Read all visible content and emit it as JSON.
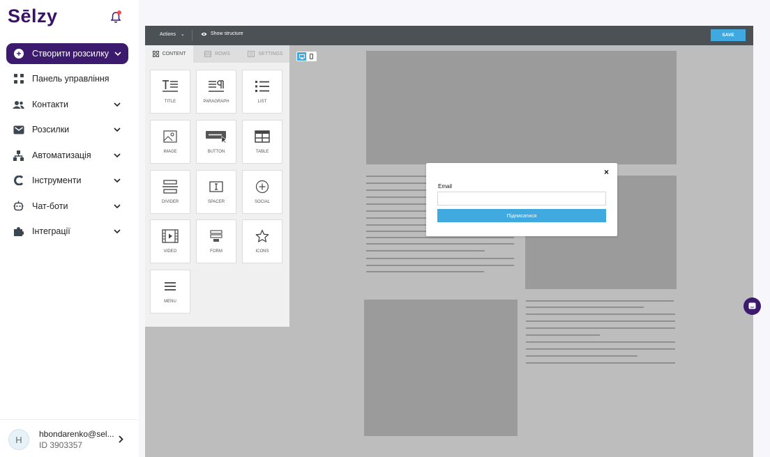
{
  "brand": {
    "logo_text": "Sēlzy",
    "accent": "#3c1a6e"
  },
  "sidebar": {
    "create_button": "Створити розсилку",
    "items": [
      {
        "label": "Панель управління",
        "icon": "dashboard-icon"
      },
      {
        "label": "Контакти",
        "icon": "contacts-icon"
      },
      {
        "label": "Розсилки",
        "icon": "mail-icon"
      },
      {
        "label": "Автоматизація",
        "icon": "automation-icon"
      },
      {
        "label": "Інструменти",
        "icon": "tools-icon"
      },
      {
        "label": "Чат-боти",
        "icon": "chatbot-icon"
      },
      {
        "label": "Інтеграції",
        "icon": "puzzle-icon"
      }
    ],
    "user": {
      "initial": "H",
      "email": "hbondarenko@sel...",
      "id": "ID 3903357"
    }
  },
  "editor": {
    "actions_label": "Actions",
    "show_structure_label": "Show structure",
    "save_label": "SAVE",
    "tabs": [
      {
        "label": "CONTENT",
        "active": true
      },
      {
        "label": "ROWS",
        "active": false
      },
      {
        "label": "SETTINGS",
        "active": false
      }
    ],
    "content_blocks": [
      {
        "label": "TITLE",
        "icon": "title-icon"
      },
      {
        "label": "PARAGRAPH",
        "icon": "paragraph-icon"
      },
      {
        "label": "LIST",
        "icon": "list-icon"
      },
      {
        "label": "IMAGE",
        "icon": "image-icon"
      },
      {
        "label": "BUTTON",
        "icon": "button-icon"
      },
      {
        "label": "TABLE",
        "icon": "table-icon"
      },
      {
        "label": "DIVIDER",
        "icon": "divider-icon"
      },
      {
        "label": "SPACER",
        "icon": "spacer-icon"
      },
      {
        "label": "SOCIAL",
        "icon": "social-icon"
      },
      {
        "label": "VIDEO",
        "icon": "video-icon"
      },
      {
        "label": "FORM",
        "icon": "form-icon"
      },
      {
        "label": "ICONS",
        "icon": "star-icon"
      },
      {
        "label": "MENU",
        "icon": "menu-icon"
      }
    ]
  },
  "popup": {
    "close_symbol": "×",
    "email_label": "Email",
    "email_value": "",
    "submit_label": "Підписатися"
  }
}
